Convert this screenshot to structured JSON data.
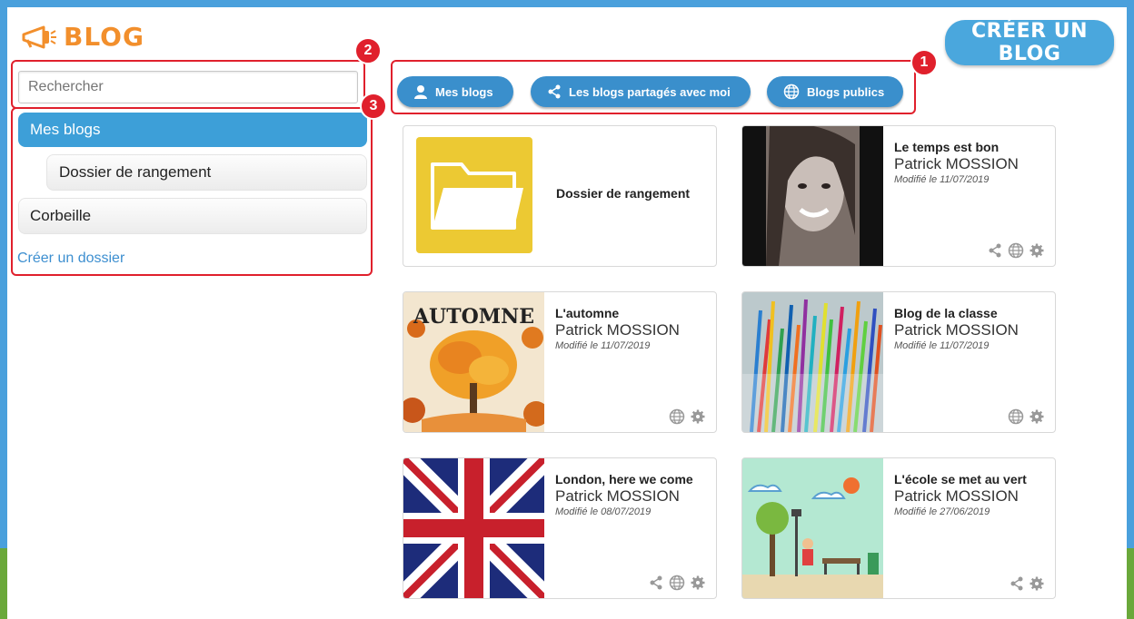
{
  "app": {
    "title": "BLOG",
    "create_blog_label": "CRÉER UN BLOG"
  },
  "search": {
    "placeholder": "Rechercher"
  },
  "sidebar": {
    "items": [
      {
        "label": "Mes blogs",
        "active": true
      },
      {
        "label": "Dossier de rangement",
        "active": false
      },
      {
        "label": "Corbeille",
        "active": false
      }
    ],
    "create_folder_label": "Créer un dossier"
  },
  "filters": [
    {
      "label": "Mes blogs",
      "icon": "user-icon"
    },
    {
      "label": "Les blogs partagés avec moi",
      "icon": "share-icon"
    },
    {
      "label": "Blogs publics",
      "icon": "globe-icon"
    }
  ],
  "annotations": [
    "1",
    "2",
    "3"
  ],
  "folder_card": {
    "label": "Dossier de rangement"
  },
  "blogs": [
    {
      "title": "Le temps est bon",
      "author": "Patrick MOSSION",
      "modified": "Modifié le 11/07/2019",
      "actions": [
        "share-icon",
        "globe-icon",
        "gear-icon"
      ]
    },
    {
      "title": "L'automne",
      "author": "Patrick MOSSION",
      "modified": "Modifié le 11/07/2019",
      "thumb_text": "AUTOMNE",
      "actions": [
        "globe-icon",
        "gear-icon"
      ]
    },
    {
      "title": "Blog de la classe",
      "author": "Patrick MOSSION",
      "modified": "Modifié le 11/07/2019",
      "actions": [
        "globe-icon",
        "gear-icon"
      ]
    },
    {
      "title": "London, here we come",
      "author": "Patrick MOSSION",
      "modified": "Modifié le 08/07/2019",
      "actions": [
        "share-icon",
        "globe-icon",
        "gear-icon"
      ]
    },
    {
      "title": "L'école se met au vert",
      "author": "Patrick MOSSION",
      "modified": "Modifié le 27/06/2019",
      "actions": [
        "share-icon",
        "gear-icon"
      ]
    }
  ],
  "colors": {
    "accent": "#4aa7dd",
    "brand": "#f28f2c",
    "annotation": "#e0202c",
    "folder": "#ecc933"
  }
}
